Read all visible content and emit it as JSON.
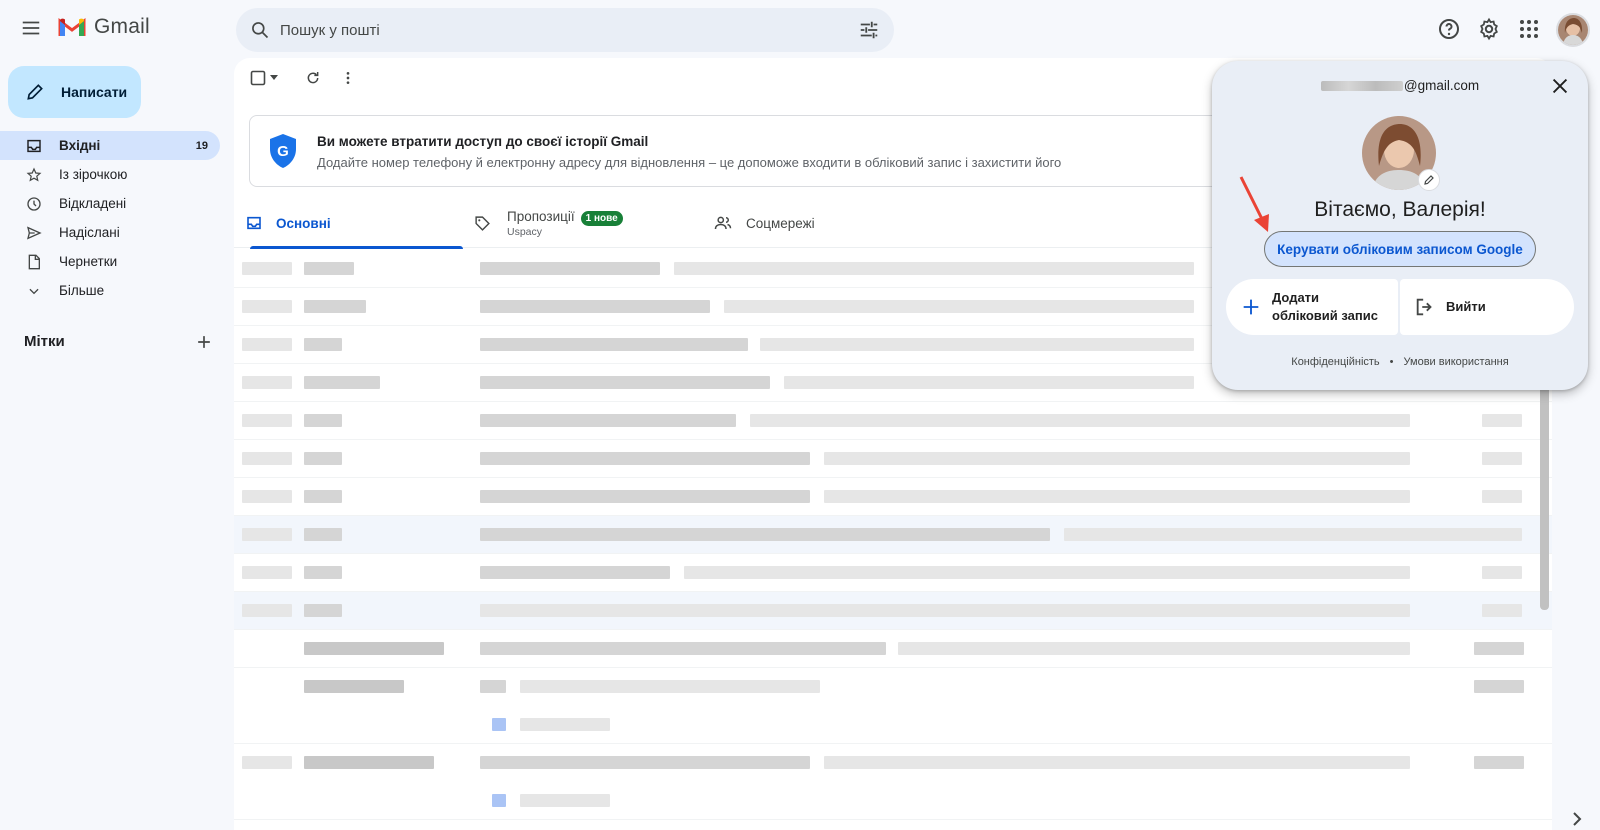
{
  "app": {
    "name": "Gmail"
  },
  "search": {
    "placeholder": "Пошук у пошті"
  },
  "sidebar": {
    "compose_label": "Написати",
    "items": [
      {
        "label": "Вхідні",
        "count": "19",
        "icon": "inbox-icon",
        "active": true
      },
      {
        "label": "Із зірочкою",
        "count": "",
        "icon": "star-icon"
      },
      {
        "label": "Відкладені",
        "count": "",
        "icon": "clock-icon"
      },
      {
        "label": "Надіслані",
        "count": "",
        "icon": "send-icon"
      },
      {
        "label": "Чернетки",
        "count": "",
        "icon": "draft-icon"
      },
      {
        "label": "Більше",
        "count": "",
        "icon": "chevron-down-icon"
      }
    ],
    "labels_heading": "Мітки"
  },
  "banner": {
    "title": "Ви можете втратити доступ до своєї історії Gmail",
    "text": "Додайте номер телефону й електронну адресу для відновлення – це допоможе входити в обліковий запис і захистити його"
  },
  "tabs": [
    {
      "label": "Основні",
      "active": true
    },
    {
      "label": "Пропозиції",
      "badge": "1 нове",
      "sub": "Uspacy"
    },
    {
      "label": "Соцмережі"
    }
  ],
  "account_popup": {
    "email_suffix": "@gmail.com",
    "greeting": "Вітаємо, Валерія!",
    "manage_label": "Керувати обліковим записом Google",
    "add_account_line1": "Додати",
    "add_account_line2": "обліковий запис",
    "sign_out_label": "Вийти",
    "privacy_label": "Конфіденційність",
    "separator": "•",
    "terms_label": "Умови використання"
  },
  "colors": {
    "accent": "#0b57d0",
    "compose_bg": "#c2e7ff",
    "active_nav_bg": "#d3e3fd",
    "badge_green": "#188038",
    "annotation_arrow": "#ea4335"
  }
}
